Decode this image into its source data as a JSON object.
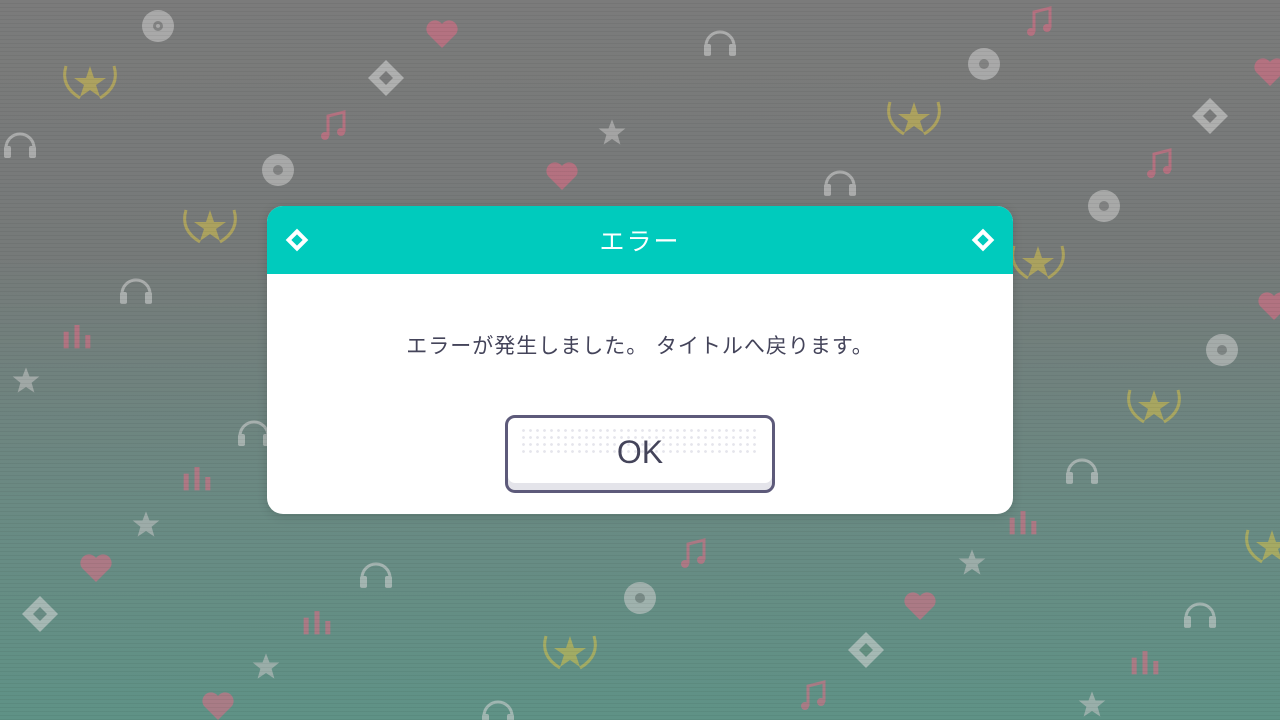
{
  "background": {
    "colors": {
      "star": "#c8c8c8",
      "heart": "#e56b86",
      "headphones": "#d6d6d6",
      "disc": "#d0d0d0",
      "wreath": "#d8c34a",
      "note": "#e56b86",
      "diamond": "#dcdcdc"
    },
    "icons": [
      "disc-icon",
      "heart-icon",
      "headphones-icon",
      "star-icon",
      "wreath-star-icon",
      "music-note-icon",
      "diamond-icon",
      "equalizer-icon"
    ]
  },
  "dialog": {
    "title": "エラー",
    "message": "エラーが発生しました。 タイトルへ戻ります。",
    "ok_label": "OK",
    "header_color": "#00cbbd",
    "text_color": "#44445a"
  }
}
